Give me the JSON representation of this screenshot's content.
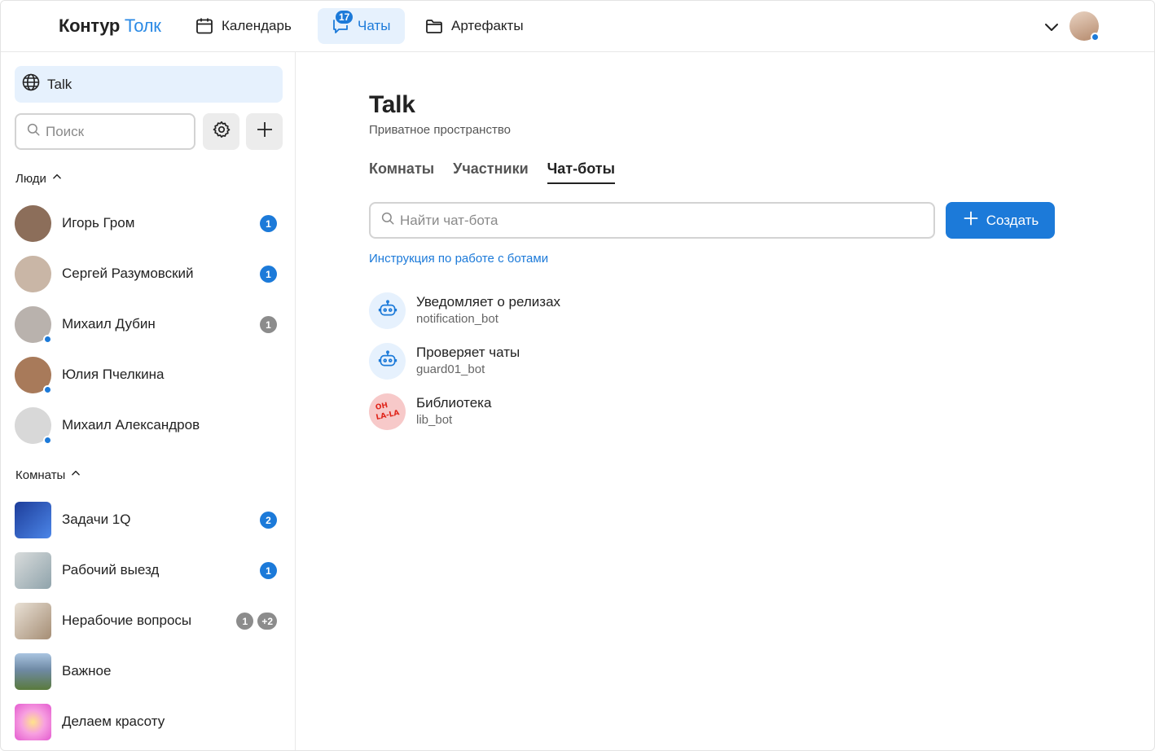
{
  "header": {
    "logo_bold": "Контур",
    "logo_accent": "Толк",
    "nav": [
      {
        "label": "Календарь",
        "icon": "calendar-icon"
      },
      {
        "label": "Чаты",
        "icon": "chat-icon",
        "badge": "17",
        "active": true
      },
      {
        "label": "Артефакты",
        "icon": "folder-icon"
      }
    ]
  },
  "sidebar": {
    "space_label": "Talk",
    "search_placeholder": "Поиск",
    "people_header": "Люди",
    "rooms_header": "Комнаты",
    "people": [
      {
        "name": "Игорь Гром",
        "badges": [
          {
            "text": "1",
            "color": "blue"
          }
        ],
        "online": false,
        "avatar_color": "#8c6e5a"
      },
      {
        "name": "Сергей Разумовский",
        "badges": [
          {
            "text": "1",
            "color": "blue"
          }
        ],
        "online": false,
        "avatar_color": "#c9b6a6"
      },
      {
        "name": "Михаил Дубин",
        "badges": [
          {
            "text": "1",
            "color": "gray"
          }
        ],
        "online": true,
        "avatar_color": "#b9b2ad"
      },
      {
        "name": "Юлия Пчелкина",
        "badges": [],
        "online": true,
        "avatar_color": "#a87a5a"
      },
      {
        "name": "Михаил Александров",
        "badges": [],
        "online": true,
        "avatar_color": "#d8d8d8"
      }
    ],
    "rooms": [
      {
        "name": "Задачи 1Q",
        "badges": [
          {
            "text": "2",
            "color": "blue"
          }
        ],
        "avatar_color": "#2a4fb3"
      },
      {
        "name": "Рабочий выезд",
        "badges": [
          {
            "text": "1",
            "color": "blue"
          }
        ],
        "avatar_color": "#b9c3c9"
      },
      {
        "name": "Нерабочие вопросы",
        "badges": [
          {
            "text": "1",
            "color": "gray"
          },
          {
            "text": "+2",
            "color": "gray"
          }
        ],
        "avatar_color": "#c6b7a5"
      },
      {
        "name": "Важное",
        "badges": [],
        "avatar_color": "#5f86b0"
      },
      {
        "name": "Делаем красоту",
        "badges": [],
        "avatar_color": "#f07ad6"
      }
    ]
  },
  "main": {
    "title": "Talk",
    "subtitle": "Приватное пространство",
    "tabs": [
      {
        "label": "Комнаты",
        "active": false
      },
      {
        "label": "Участники",
        "active": false
      },
      {
        "label": "Чат-боты",
        "active": true
      }
    ],
    "search_placeholder": "Найти чат-бота",
    "create_label": "Создать",
    "help_link": "Инструкция по работе с ботами",
    "bots": [
      {
        "name": "Уведомляет о релизах",
        "handle": "notification_bot",
        "icon": "robot-icon"
      },
      {
        "name": "Проверяет чаты",
        "handle": "guard01_bot",
        "icon": "robot-icon"
      },
      {
        "name": "Библиотека",
        "handle": "lib_bot",
        "icon": "library-logo",
        "logo_text": "OH LA-LA"
      }
    ]
  },
  "colors": {
    "accent": "#1c7ad9",
    "accent_bg": "#e6f1fd",
    "badge_gray": "#8c8c8c"
  }
}
